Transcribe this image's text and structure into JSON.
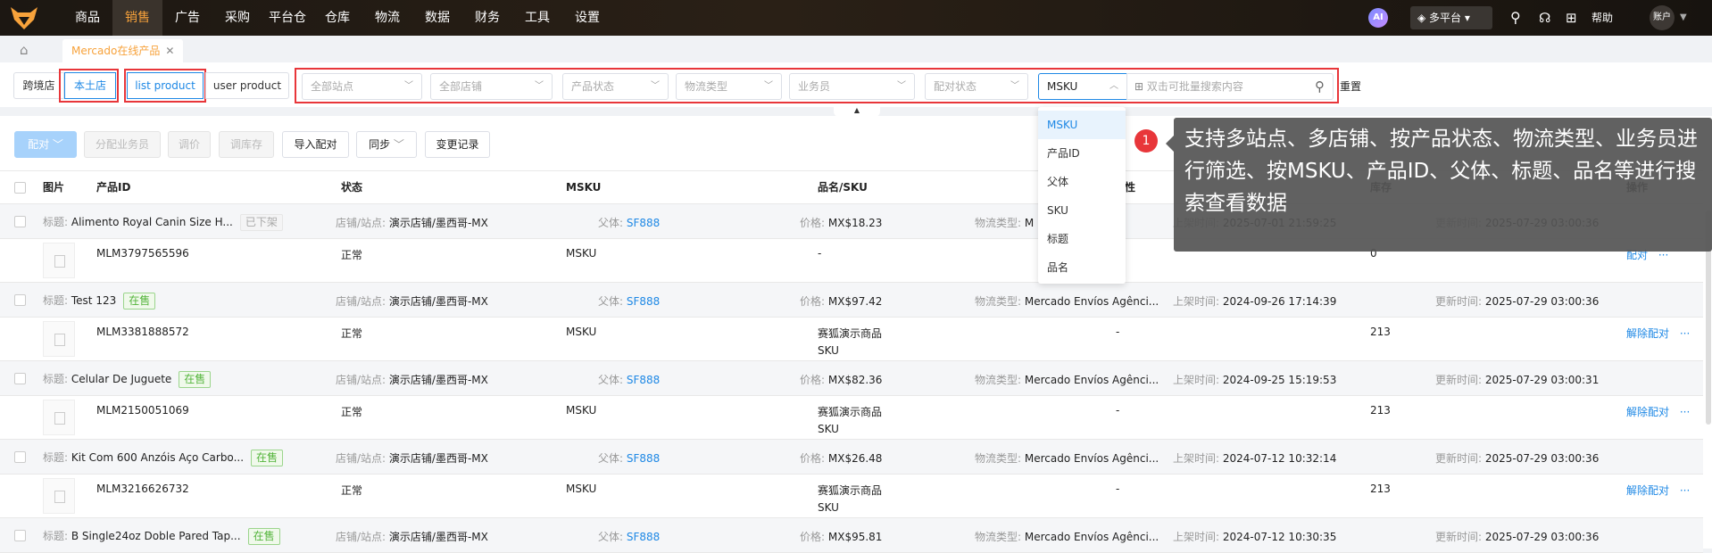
{
  "nav": {
    "menu": [
      "商品",
      "销售",
      "广告",
      "采购",
      "平台仓",
      "仓库",
      "物流",
      "数据",
      "财务",
      "工具",
      "设置"
    ],
    "active": "销售",
    "ai": "AI",
    "platform": "多平台",
    "help": "帮助",
    "account": "账户"
  },
  "tabs": {
    "active_tab": "Mercado在线产品"
  },
  "filters": {
    "shop_types": [
      "跨境店",
      "本土店"
    ],
    "list_types": [
      "list product",
      "user product"
    ],
    "selects": [
      "全部站点",
      "全部店铺",
      "产品状态",
      "物流类型",
      "业务员",
      "配对状态"
    ],
    "search_field": "MSKU",
    "search_placeholder": "双击可批量搜索内容",
    "reset": "重置"
  },
  "search_options": [
    "MSKU",
    "产品ID",
    "父体",
    "SKU",
    "标题",
    "品名"
  ],
  "actions": {
    "pair": "配对",
    "assign": "分配业务员",
    "price": "调价",
    "stock": "调库存",
    "import": "导入配对",
    "sync": "同步",
    "changelog": "变更记录"
  },
  "columns": [
    "图片",
    "产品ID",
    "状态",
    "MSKU",
    "品名/SKU",
    "属性",
    "库存",
    "操作"
  ],
  "labels": {
    "title": "标题:",
    "shop": "店铺/站点:",
    "parent": "父体:",
    "price": "价格:",
    "logistics": "物流类型:",
    "listed": "上架时间:",
    "updated": "更新时间:",
    "more": "···"
  },
  "rows": [
    {
      "title": "Alimento Royal Canin Size H...",
      "tag": "已下架",
      "shop": "演示店铺/墨西哥-MX",
      "parent": "SF888",
      "price": "MX$18.23",
      "logistics": "M",
      "listed": "2025-07-01 21:59:25",
      "updated": "2025-07-29 03:00:36",
      "id": "MLM3797565596",
      "status": "正常",
      "msku": "MSKU",
      "name": "-",
      "sku": "",
      "attr": "",
      "stock": "0",
      "op": "配对"
    },
    {
      "title": "Test 123",
      "tag": "在售",
      "shop": "演示店铺/墨西哥-MX",
      "parent": "SF888",
      "price": "MX$97.42",
      "logistics": "Mercado Envíos Agênci...",
      "listed": "2024-09-26 17:14:39",
      "updated": "2025-07-29 03:00:36",
      "id": "MLM3381888572",
      "status": "正常",
      "msku": "MSKU",
      "name": "赛狐演示商品",
      "sku": "SKU",
      "attr": "-",
      "stock": "213",
      "op": "解除配对"
    },
    {
      "title": "Celular De Juguete",
      "tag": "在售",
      "shop": "演示店铺/墨西哥-MX",
      "parent": "SF888",
      "price": "MX$82.36",
      "logistics": "Mercado Envíos Agênci...",
      "listed": "2024-09-25 15:19:53",
      "updated": "2025-07-29 03:00:31",
      "id": "MLM2150051069",
      "status": "正常",
      "msku": "MSKU",
      "name": "赛狐演示商品",
      "sku": "SKU",
      "attr": "-",
      "stock": "213",
      "op": "解除配对"
    },
    {
      "title": "Kit Com 600 Anzóis Aço Carbo...",
      "tag": "在售",
      "shop": "演示店铺/墨西哥-MX",
      "parent": "SF888",
      "price": "MX$26.48",
      "logistics": "Mercado Envíos Agênci...",
      "listed": "2024-07-12 10:32:14",
      "updated": "2025-07-29 03:00:36",
      "id": "MLM3216626732",
      "status": "正常",
      "msku": "MSKU",
      "name": "赛狐演示商品",
      "sku": "SKU",
      "attr": "-",
      "stock": "213",
      "op": "解除配对"
    },
    {
      "title": "B Single24oz Doble Pared Tap...",
      "tag": "在售",
      "shop": "演示店铺/墨西哥-MX",
      "parent": "SF888",
      "price": "MX$95.81",
      "logistics": "Mercado Envíos Agênci...",
      "listed": "2024-07-12 10:30:35",
      "updated": "2025-07-29 03:00:36"
    }
  ],
  "tooltip": {
    "badge": "1",
    "text": "支持多站点、多店铺、按产品状态、物流类型、业务员进行筛选、按MSKU、产品ID、父体、标题、品名等进行搜索查看数据"
  }
}
